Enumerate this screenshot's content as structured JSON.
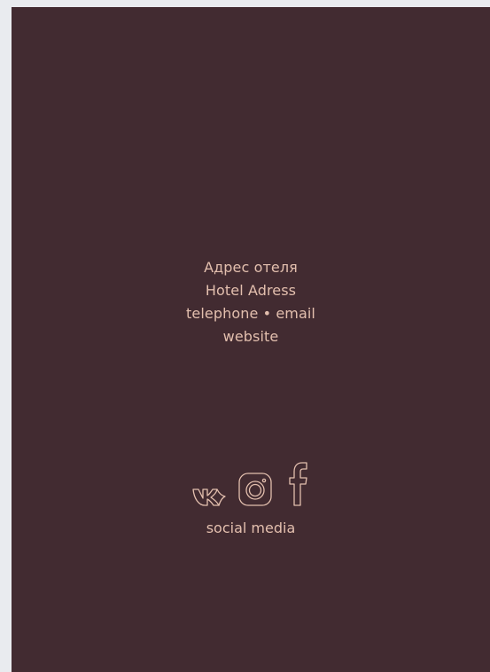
{
  "colors": {
    "background": "#e9ebef",
    "card": "#422b31",
    "text": "#e3bfae"
  },
  "address": {
    "line_ru": "Адрес отеля",
    "line_en": "Hotel Adress",
    "contact": "telephone • email",
    "website": "website"
  },
  "social": {
    "icons": [
      "vk-icon",
      "instagram-icon",
      "facebook-icon"
    ],
    "label": "social media"
  }
}
